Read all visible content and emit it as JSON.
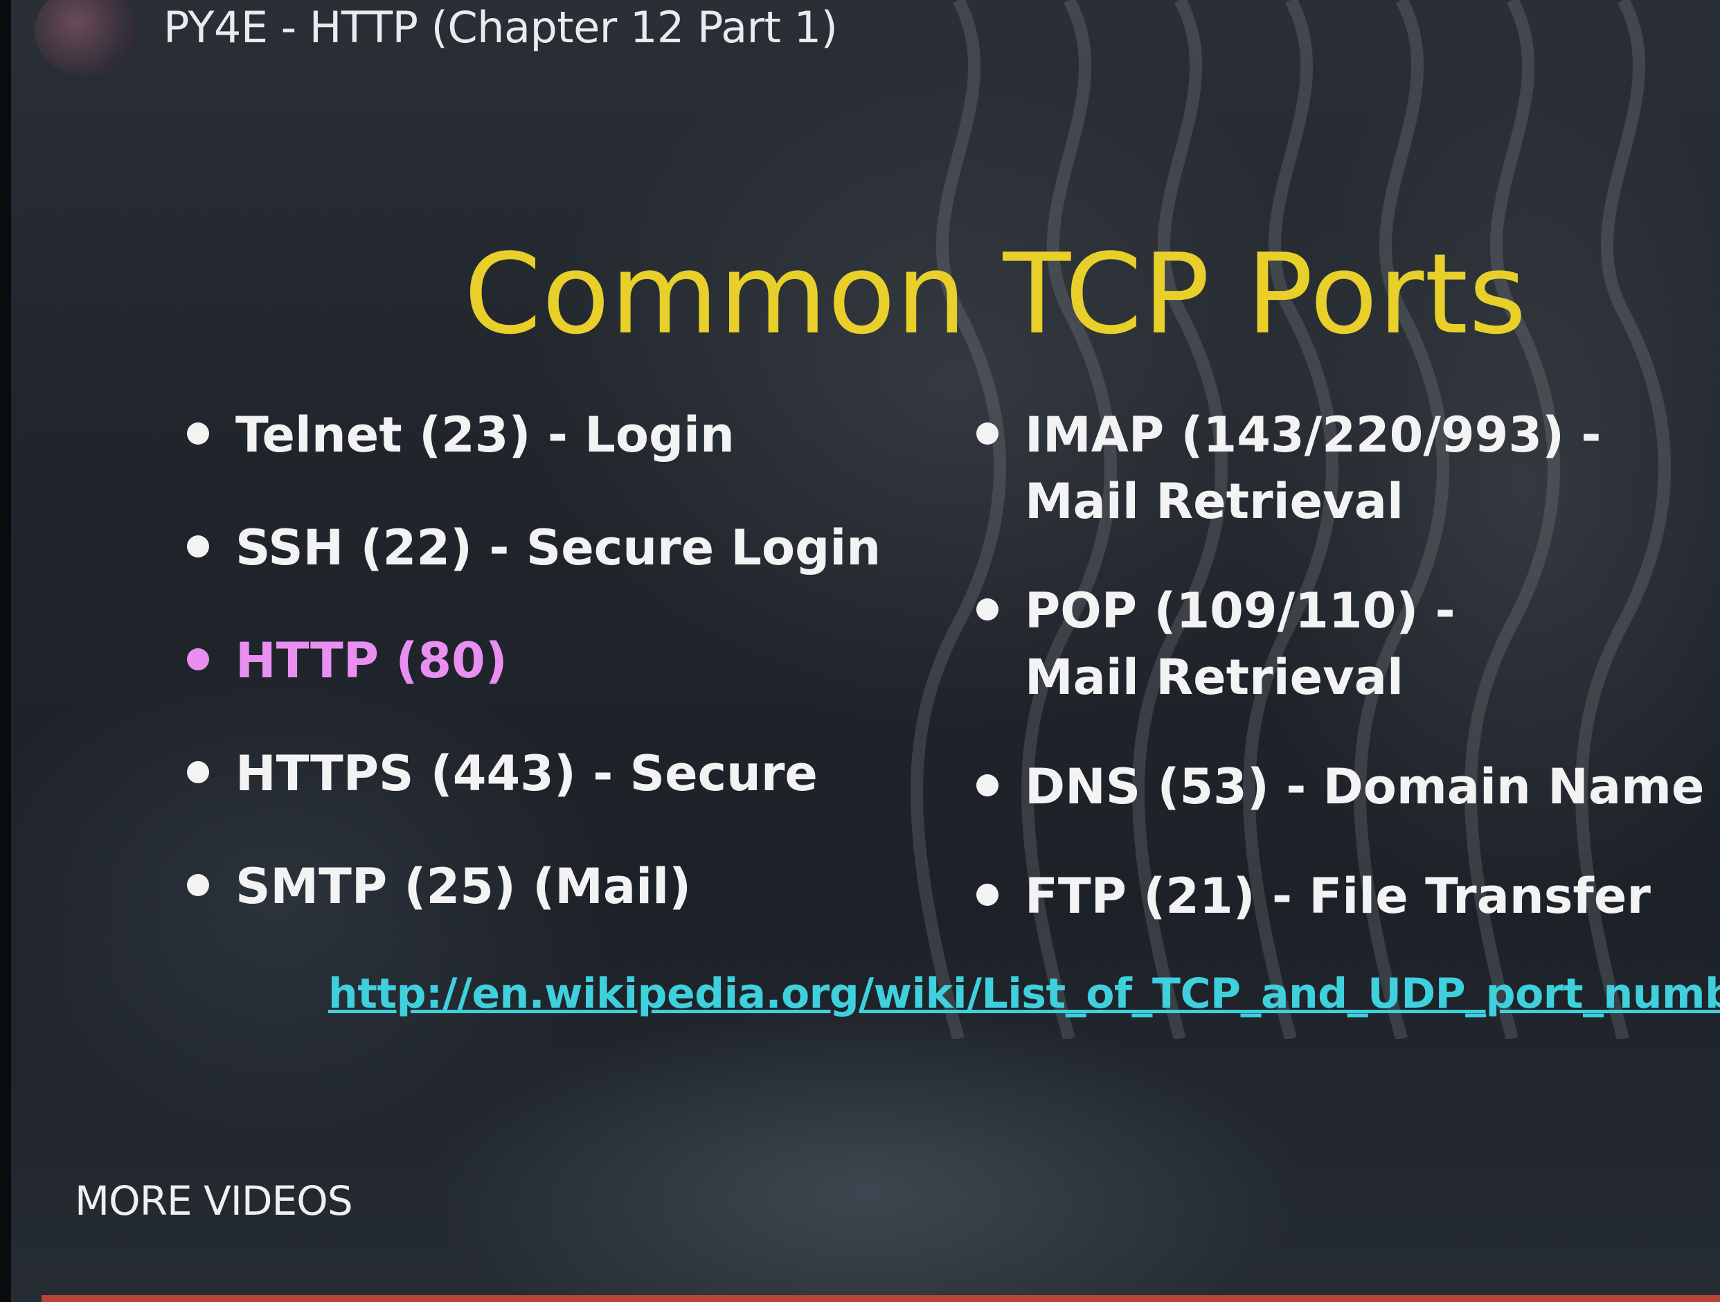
{
  "player": {
    "video_title": "PY4E - HTTP (Chapter 12 Part 1)",
    "more_videos_label": "MORE VIDEOS"
  },
  "slide": {
    "title": "Common TCP Ports",
    "left_bullets": [
      "Telnet (23) - Login",
      "SSH (22) - Secure Login",
      "HTTP (80)",
      "HTTPS (443) - Secure",
      "SMTP (25) (Mail)"
    ],
    "right_bullets": [
      "IMAP (143/220/993) - Mail Retrieval",
      "POP (109/110) - Mail Retrieval",
      "DNS (53) - Domain Name",
      "FTP (21) - File Transfer"
    ],
    "link_text": "http://en.wikipedia.org/wiki/List_of_TCP_and_UDP_port_numbers"
  },
  "colors": {
    "title": "#e8cf2a",
    "bullet_text": "#f3f3f3",
    "highlight": "#ea8ff2",
    "link": "#3fd0de",
    "progress_bar": "#b6433a"
  }
}
